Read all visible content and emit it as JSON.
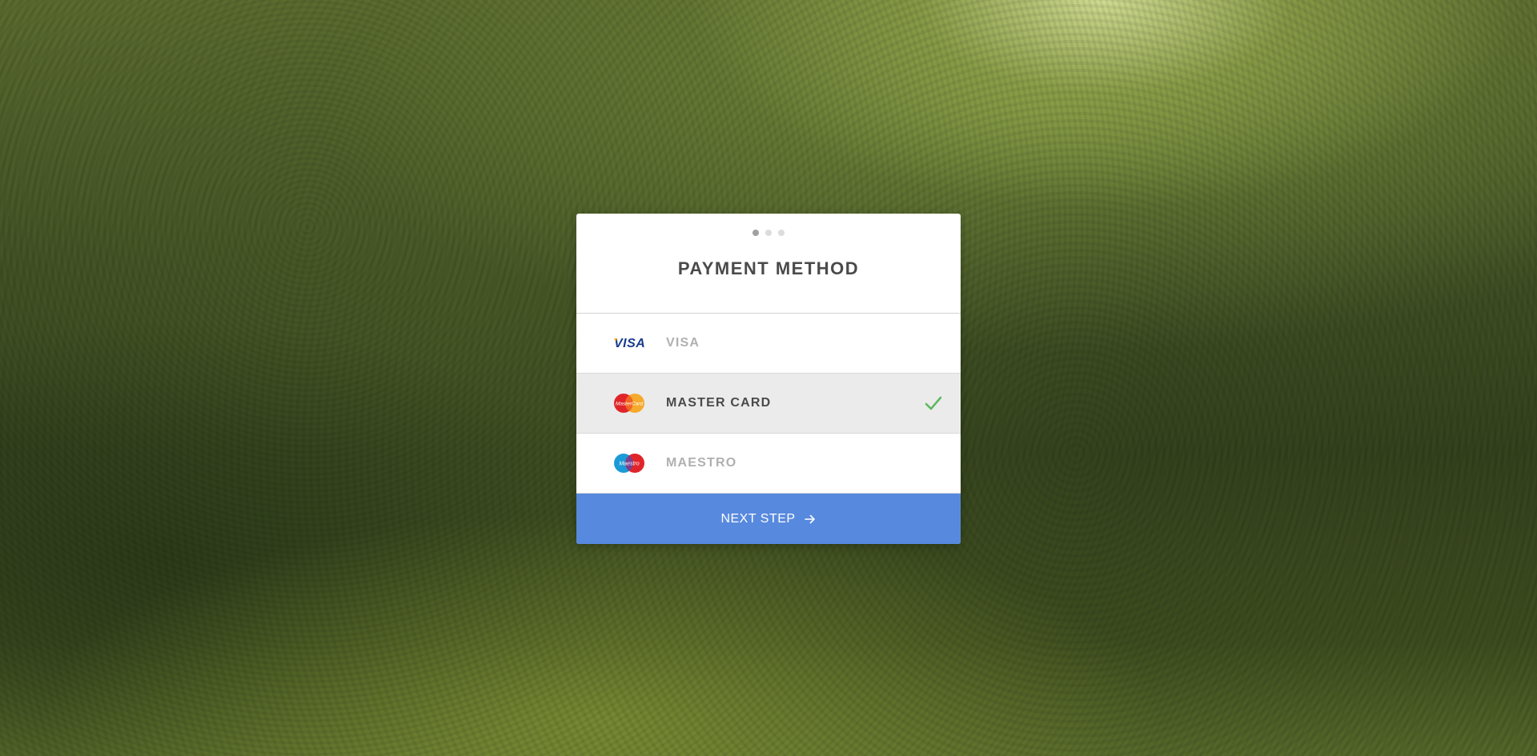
{
  "background": {
    "description_colors": [
      "#5b6b2f",
      "#34421d",
      "#d5e2a0"
    ]
  },
  "card": {
    "steps": {
      "total": 3,
      "current": 1
    },
    "title": "PAYMENT METHOD",
    "options": [
      {
        "label": "VISA",
        "logo": "visa-logo",
        "selected": false
      },
      {
        "label": "MASTER CARD",
        "logo": "mastercard-logo",
        "selected": true
      },
      {
        "label": "MAESTRO",
        "logo": "maestro-logo",
        "selected": false
      }
    ],
    "next_label": "NEXT STEP",
    "next_icon": "arrow-right-icon"
  },
  "colors": {
    "accent": "#5789de",
    "check": "#5cb85c",
    "selected_bg": "#ebebeb",
    "title_text": "#4a4a4a",
    "muted_text": "#b0b0b0"
  }
}
